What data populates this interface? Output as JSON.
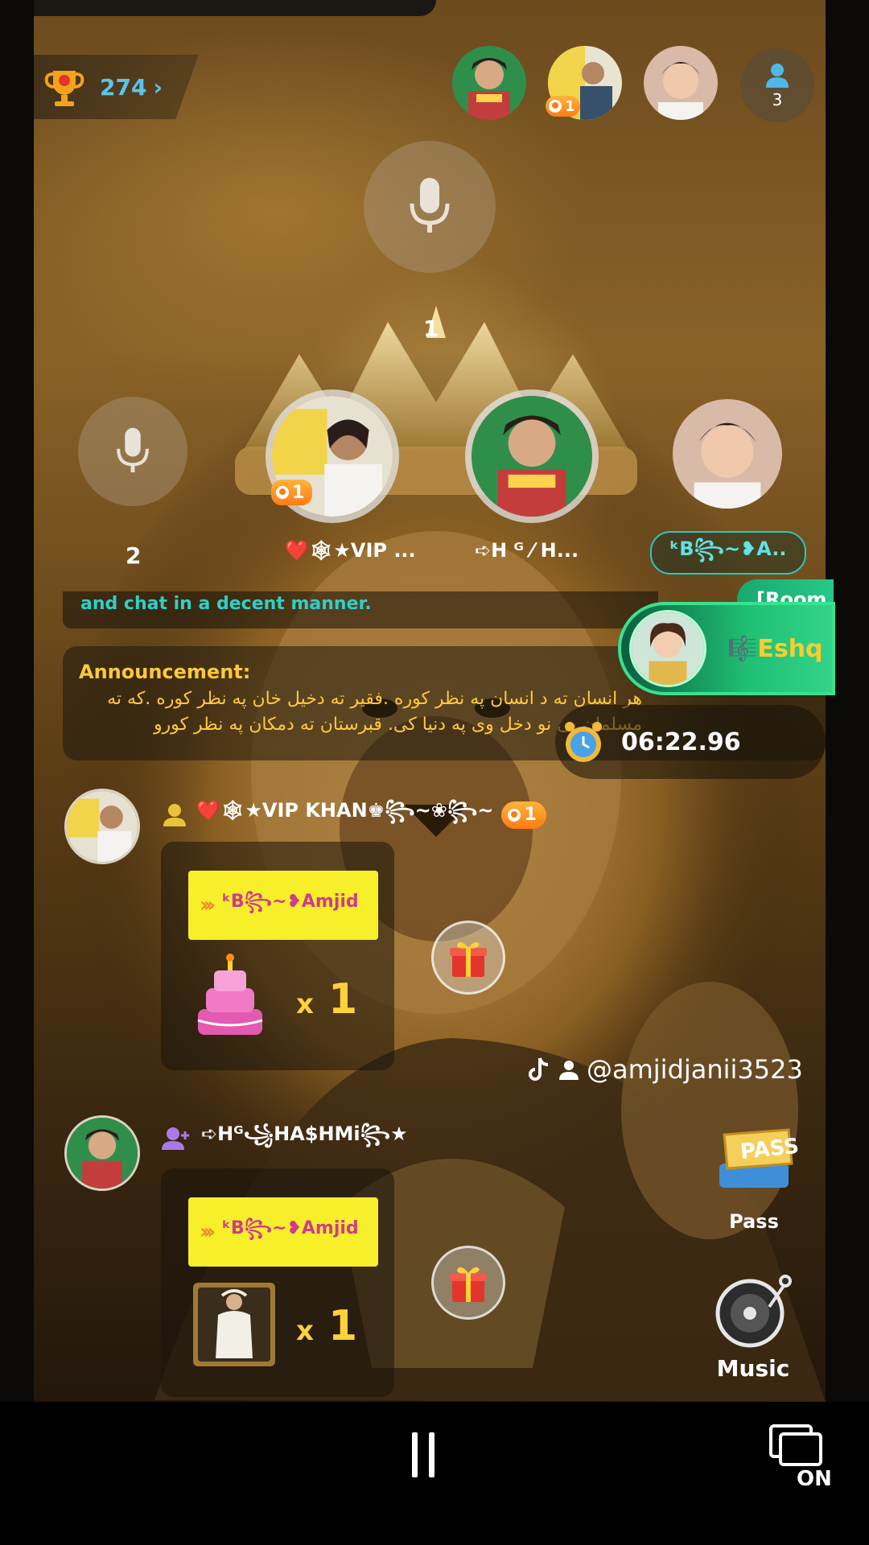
{
  "room": {
    "trophy_count": "274",
    "viewer_count": "3",
    "host_seat_number": "1",
    "seat_two_number": "2",
    "room_tag": "[Room",
    "notice_fragment": "and chat in a decent manner.",
    "entry_name": "🎼Eshq"
  },
  "top_avatars": [
    {
      "name": "hashmi-top-avatar",
      "badge": ""
    },
    {
      "name": "vip-top-avatar",
      "badge": "1"
    },
    {
      "name": "boy-top-avatar",
      "badge": ""
    }
  ],
  "seats": [
    {
      "label": "❤️🕸★VIP ...",
      "badge": "1"
    },
    {
      "label": "➪H ᴳ ⁄ H...",
      "badge": ""
    },
    {
      "label": "ᵏB꧂~❥A..",
      "badge": ""
    }
  ],
  "announcement": {
    "title": "Announcement:",
    "text": "هر انسان ته د انسان په نظر کوره .فقیر ته دخیل خان په نظر کوره .که ته مسلمان یی نو دخل وی په دنیا کی. قبرستان ته دمکان په نظر کورو"
  },
  "timer": {
    "value": "06:22.96"
  },
  "messages": [
    {
      "sender": "❤️🕸★VIP KHAN♚꧂~❀꧂~",
      "level": "1",
      "gift_to": "ᵏB꧂~❥Amjid",
      "gift_item": "cake",
      "qty": "1",
      "qty_prefix": "x"
    },
    {
      "sender": "➪Hᴳ꧁HA$HMi꧂★",
      "level": "",
      "gift_to": "ᵏB꧂~❥Amjid",
      "gift_item": "king-statue",
      "qty": "1",
      "qty_prefix": "x"
    }
  ],
  "watermark": {
    "handle": "@amjidjanii3523"
  },
  "side_buttons": {
    "pass": "Pass",
    "music": "Music",
    "pass_art": "PASS"
  },
  "nav": {
    "cast_label": "ON"
  },
  "colors": {
    "accent_teal": "#2ec6c0",
    "gold": "#ffc93b",
    "badge_orange": "#ff7b16",
    "green": "#25c98a"
  }
}
